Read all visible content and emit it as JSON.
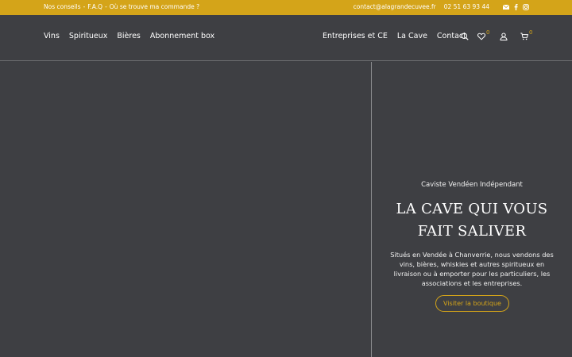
{
  "topbar": {
    "links": [
      "Nos conseils",
      "-",
      "F.A.Q",
      "-",
      "Où se trouve ma commande ?"
    ],
    "email": "contact@alagrandecuvee.fr",
    "phone": "02 51 63 93 44",
    "social_icons": [
      "mail-icon",
      "facebook-icon",
      "instagram-icon"
    ],
    "bg_color": "#d4a419"
  },
  "nav": {
    "left": [
      "Vins",
      "Spiritueux",
      "Bières",
      "Abonnement box"
    ],
    "right": [
      "Entreprises et CE",
      "La Cave",
      "Contact"
    ],
    "wishlist_count": "0",
    "cart_count": "0",
    "icons": [
      "search-icon",
      "heart-icon",
      "user-icon",
      "cart-icon"
    ]
  },
  "hero": {
    "kicker": "Caviste Vendéen Indépendant",
    "title_line1": "LA CAVE QUI VOUS",
    "title_line2": "FAIT SALIVER",
    "description": "Situés en Vendée à Chanverrie, nous vendons des vins, bières, whiskies et autres spiritueux en livraison ou à emporter pour les particuliers, les associations et les entreprises.",
    "button": "Visiter la boutique",
    "accent": "#d4a419"
  }
}
